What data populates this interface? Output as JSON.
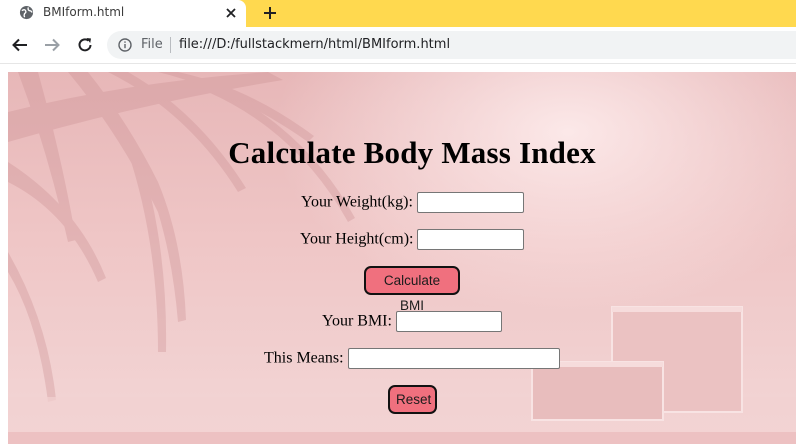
{
  "browser": {
    "tab_title": "BMIform.html",
    "url_scheme_label": "File",
    "url": "file:///D:/fullstackmern/html/BMIform.html"
  },
  "icons": {
    "favicon": "globe-icon",
    "tab_close": "close-icon",
    "new_tab": "plus-icon",
    "back": "arrow-left-icon",
    "forward": "arrow-right-icon",
    "reload": "reload-icon",
    "site_info": "info-icon"
  },
  "colors": {
    "tabstrip": "#ffd94f",
    "button_fill": "#f0707e",
    "page_pink": "#efc6c6"
  },
  "form": {
    "heading": "Calculate Body Mass Index",
    "weight_label": "Your Weight(kg):",
    "weight_value": "",
    "height_label": "Your Height(cm):",
    "height_value": "",
    "calculate_label": "Calculate BMI",
    "bmi_label": "Your BMI:",
    "bmi_value": "",
    "meaning_label": "This Means:",
    "meaning_value": "",
    "reset_label": "Reset"
  }
}
